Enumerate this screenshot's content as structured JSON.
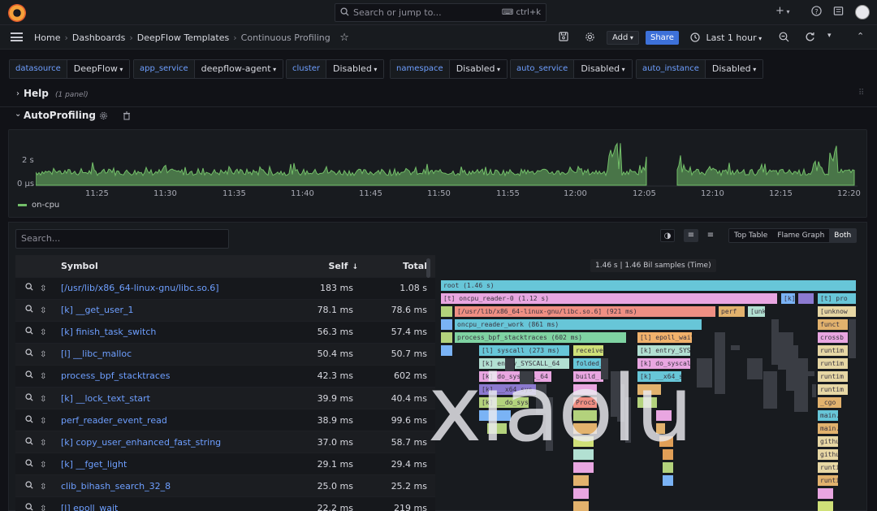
{
  "topbar": {
    "search_placeholder": "Search or jump to...",
    "search_shortcut": "ctrl+k",
    "plus": "+",
    "help_icon": "help-icon",
    "news_icon": "news-icon"
  },
  "breadcrumb": [
    "Home",
    "Dashboards",
    "DeepFlow Templates",
    "Continuous Profiling"
  ],
  "toolbar": {
    "add_label": "Add",
    "share_label": "Share",
    "time_range": "Last 1 hour"
  },
  "variables": [
    {
      "label": "datasource",
      "value": "DeepFlow"
    },
    {
      "label": "app_service",
      "value": "deepflow-agent"
    },
    {
      "label": "cluster",
      "value": "Disabled"
    },
    {
      "label": "namespace",
      "value": "Disabled"
    },
    {
      "label": "auto_service",
      "value": "Disabled"
    },
    {
      "label": "auto_instance",
      "value": "Disabled"
    }
  ],
  "rows": {
    "help": {
      "title": "Help",
      "subtitle": "(1 panel)"
    },
    "autoprofiling": {
      "title": "AutoProfiling"
    }
  },
  "timeseries": {
    "y_ticks": [
      "2 s",
      "0 µs"
    ],
    "x_ticks": [
      "11:25",
      "11:30",
      "11:35",
      "11:40",
      "11:45",
      "11:50",
      "11:55",
      "12:00",
      "12:05",
      "12:10",
      "12:15",
      "12:20"
    ],
    "legend": "on-cpu",
    "series_color": "#73bf69"
  },
  "profile": {
    "search_placeholder": "Search...",
    "view_buttons": [
      "Top Table",
      "Flame Graph",
      "Both"
    ],
    "active_view": "Both",
    "columns": {
      "symbol": "Symbol",
      "self": "Self",
      "total": "Total"
    },
    "rows": [
      {
        "symbol": "[/usr/lib/x86_64-linux-gnu/libc.so.6]",
        "self": "183 ms",
        "total": "1.08 s"
      },
      {
        "symbol": "[k] __get_user_1",
        "self": "78.1 ms",
        "total": "78.6 ms"
      },
      {
        "symbol": "[k] finish_task_switch",
        "self": "56.3 ms",
        "total": "57.4 ms"
      },
      {
        "symbol": "[l] __libc_malloc",
        "self": "50.4 ms",
        "total": "50.7 ms"
      },
      {
        "symbol": "process_bpf_stacktraces",
        "self": "42.3 ms",
        "total": "602 ms"
      },
      {
        "symbol": "[k] __lock_text_start",
        "self": "39.9 ms",
        "total": "40.4 ms"
      },
      {
        "symbol": "perf_reader_event_read",
        "self": "38.9 ms",
        "total": "99.6 ms"
      },
      {
        "symbol": "[k] copy_user_enhanced_fast_string",
        "self": "37.0 ms",
        "total": "58.7 ms"
      },
      {
        "symbol": "[k] __fget_light",
        "self": "29.1 ms",
        "total": "29.4 ms"
      },
      {
        "symbol": "clib_bihash_search_32_8",
        "self": "25.0 ms",
        "total": "25.2 ms"
      },
      {
        "symbol": "[l] epoll_wait",
        "self": "22.2 ms",
        "total": "219 ms"
      }
    ],
    "flame_title": "1.46 s | 1.46 Bil samples (Time)",
    "flame_labels": {
      "root": "root (1.46 s)",
      "oncpu_reader": "[t] oncpu_reader-0 (1.12 s)",
      "libc": "[/usr/lib/x86_64-linux-gnu/libc.so.6] (921 ms)",
      "reader_work": "oncpu_reader_work (861 ms)",
      "process": "process_bpf_stacktraces (602 ms)",
      "syscall": "[l] syscall (273 ms)",
      "entry": "[k] entry_SYSCALL_64",
      "do_syscall": "[k] do_syscall_64",
      "x64_sys": "[k] __x64_sys_bpf",
      "do_sys": "[k] __do_sys_bpf",
      "epoll": "[l] epoll_wait",
      "entry2": "[k] entry_SYSC",
      "do_sys2": "[k] do_syscal",
      "x64_2": "[k] __x64_s",
      "receive": "receive",
      "folded": "folded_",
      "build": "build_",
      "proc": "ProcS",
      "perf": "perf",
      "unk": "[unk",
      "k1": "[k]",
      "t1": "[t]",
      "t2": "[t] pro",
      "unknown": "[unknow",
      "funct": "funct",
      "crossb": "crossb",
      "runtime": "runtim",
      "cgo": "_cgo",
      "main": "main.",
      "github": "githu"
    }
  },
  "watermark": "xiaolu"
}
